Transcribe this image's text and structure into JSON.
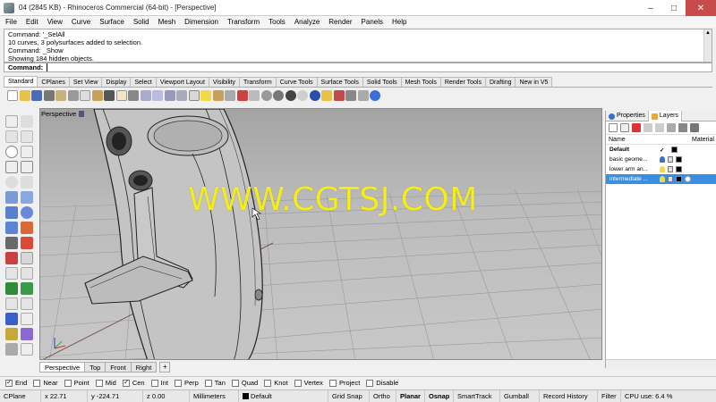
{
  "window": {
    "title": "04 (2845 KB) - Rhinoceros Commercial (64-bit) - [Perspective]",
    "controls": [
      "minimize-icon",
      "maximize-icon",
      "close-icon"
    ]
  },
  "menu": [
    "File",
    "Edit",
    "View",
    "Curve",
    "Surface",
    "Solid",
    "Mesh",
    "Dimension",
    "Transform",
    "Tools",
    "Analyze",
    "Render",
    "Panels",
    "Help"
  ],
  "command": {
    "history": [
      "Command: '_SelAll",
      "10 curves, 3 polysurfaces added to selection.",
      "Command: _Show",
      "Showing 184 hidden objects."
    ],
    "prompt": "Command:"
  },
  "tabs": [
    "Standard",
    "CPlanes",
    "Set View",
    "Display",
    "Select",
    "Viewport Layout",
    "Visibility",
    "Transform",
    "Curve Tools",
    "Surface Tools",
    "Solid Tools",
    "Mesh Tools",
    "Render Tools",
    "Drafting",
    "New in V5"
  ],
  "active_tab": "Standard",
  "viewport": {
    "label": "Perspective",
    "watermark": "WWW.CGTSJ.COM",
    "background": "#b8b8b8"
  },
  "view_tabs": [
    "Perspective",
    "Top",
    "Front",
    "Right"
  ],
  "active_view_tab": "Perspective",
  "right_panel": {
    "tabs": [
      "Properties",
      "Layers"
    ],
    "active_tab": "Layers",
    "header": {
      "name": "Name",
      "material": "Material"
    },
    "layers": [
      {
        "name": "Default",
        "current": true,
        "selected": false,
        "color": "#000000"
      },
      {
        "name": "basic geome...",
        "current": false,
        "selected": false,
        "color": "#000000"
      },
      {
        "name": "lower arm an...",
        "current": false,
        "selected": false,
        "color": "#000000"
      },
      {
        "name": "intermediate ...",
        "current": false,
        "selected": true,
        "color": "#000000"
      }
    ],
    "current_mark": "✓"
  },
  "osnaps": [
    {
      "label": "End",
      "checked": true
    },
    {
      "label": "Near",
      "checked": false
    },
    {
      "label": "Point",
      "checked": false
    },
    {
      "label": "Mid",
      "checked": false
    },
    {
      "label": "Cen",
      "checked": true
    },
    {
      "label": "Int",
      "checked": false
    },
    {
      "label": "Perp",
      "checked": false
    },
    {
      "label": "Tan",
      "checked": false
    },
    {
      "label": "Quad",
      "checked": false
    },
    {
      "label": "Knot",
      "checked": false
    },
    {
      "label": "Vertex",
      "checked": false
    },
    {
      "label": "Project",
      "checked": false
    },
    {
      "label": "Disable",
      "checked": false
    }
  ],
  "status": {
    "cplane": "CPlane",
    "x": "x 22.71",
    "y": "y -224.71",
    "z": "z 0.00",
    "units": "Millimeters",
    "layer": "Default",
    "grid_snap": "Grid Snap",
    "ortho": "Ortho",
    "planar": "Planar",
    "osnap": "Osnap",
    "smarttrack": "SmartTrack",
    "gumball": "Gumball",
    "record_history": "Record History",
    "filter": "Filter",
    "cpu": "CPU use: 6.4 %"
  },
  "colors": {
    "accent": "#3b8fe0",
    "watermark": "#f4ec1c",
    "close_button": "#c74b4b"
  }
}
